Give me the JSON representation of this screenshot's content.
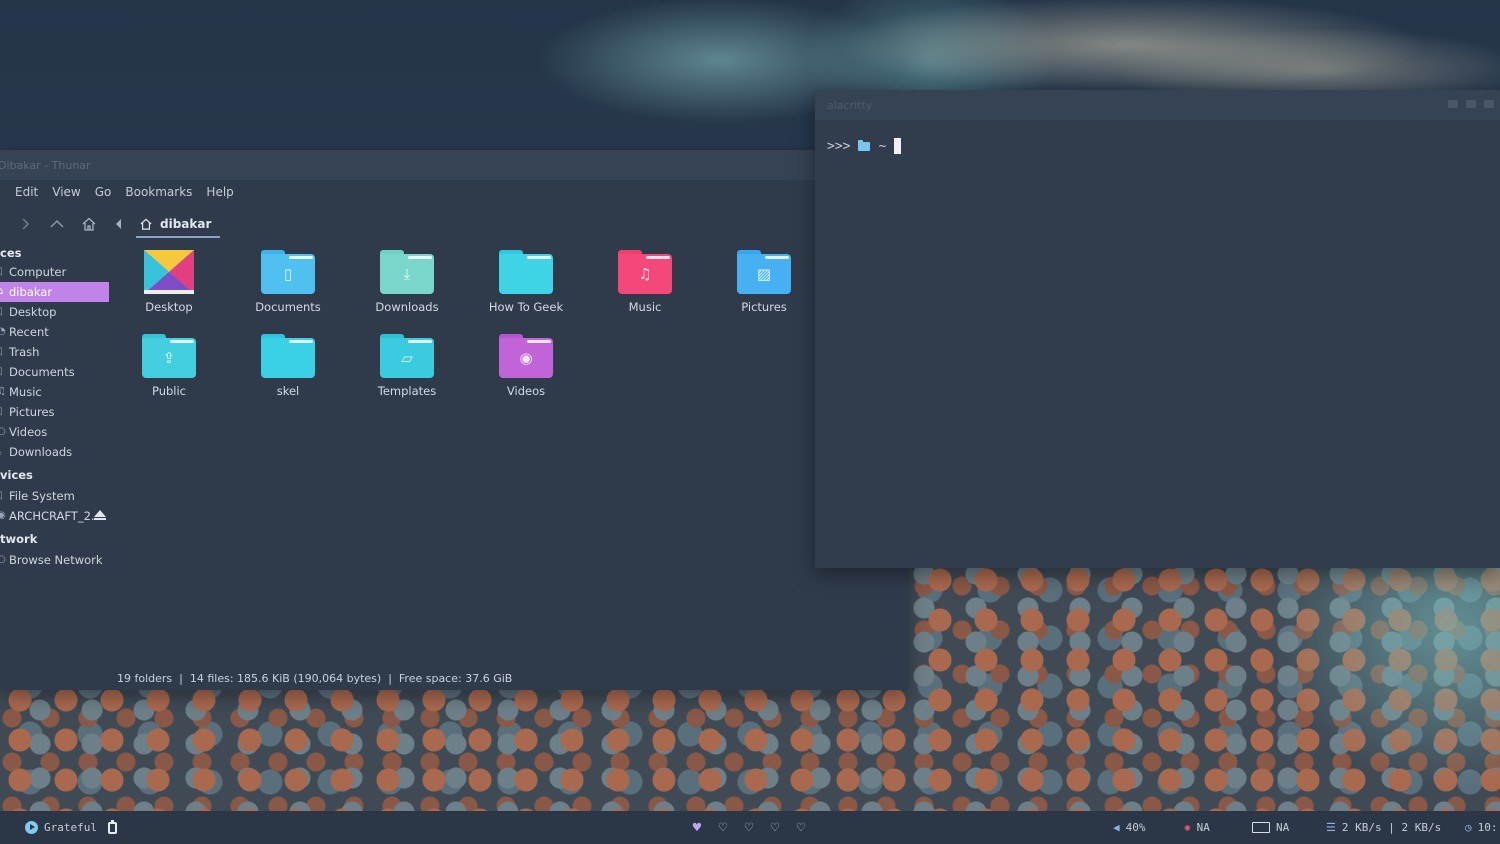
{
  "file_manager": {
    "title": "Dibakar - Thunar",
    "menu": [
      "Edit",
      "View",
      "Go",
      "Bookmarks",
      "Help"
    ],
    "path": "dibakar",
    "sidebar": {
      "places_header": "ces",
      "places": [
        {
          "label": "Computer",
          "icon": "computer-icon"
        },
        {
          "label": "dibakar",
          "icon": "home-icon",
          "active": true
        },
        {
          "label": "Desktop",
          "icon": "desktop-icon"
        },
        {
          "label": "Recent",
          "icon": "recent-icon"
        },
        {
          "label": "Trash",
          "icon": "trash-icon"
        },
        {
          "label": "Documents",
          "icon": "documents-icon"
        },
        {
          "label": "Music",
          "icon": "music-icon"
        },
        {
          "label": "Pictures",
          "icon": "pictures-icon"
        },
        {
          "label": "Videos",
          "icon": "videos-icon"
        },
        {
          "label": "Downloads",
          "icon": "downloads-icon"
        }
      ],
      "devices_header": "vices",
      "devices": [
        {
          "label": "File System",
          "icon": "drive-icon"
        },
        {
          "label": "ARCHCRAFT_2...",
          "icon": "disc-icon"
        }
      ],
      "network_header": "twork",
      "network": [
        {
          "label": "Browse Network",
          "icon": "network-icon"
        }
      ]
    },
    "items": [
      {
        "label": "Desktop",
        "kind": "desktop",
        "color": "#e06fb0"
      },
      {
        "label": "Documents",
        "kind": "folder",
        "color": "#3fb2e8",
        "icon": "document-icon"
      },
      {
        "label": "Downloads",
        "kind": "folder",
        "color": "#6fcfc0",
        "icon": "download-icon"
      },
      {
        "label": "How To Geek",
        "kind": "folder",
        "color": "#2fc8de",
        "icon": ""
      },
      {
        "label": "Music",
        "kind": "folder",
        "color": "#ef3f6e",
        "icon": "music-note-icon"
      },
      {
        "label": "Pictures",
        "kind": "folder",
        "color": "#3aa4ec",
        "icon": "image-icon"
      },
      {
        "label": "Public",
        "kind": "folder",
        "color": "#35c4d6",
        "icon": "share-icon"
      },
      {
        "label": "skel",
        "kind": "folder",
        "color": "#2cc5dd",
        "icon": ""
      },
      {
        "label": "Templates",
        "kind": "folder",
        "color": "#2cc0d6",
        "icon": "template-icon"
      },
      {
        "label": "Videos",
        "kind": "folder",
        "color": "#b455cf",
        "icon": "play-icon"
      }
    ],
    "status": "19 folders  |  14 files: 185.6 KiB (190,064 bytes)  |  Free space: 37.6 GiB"
  },
  "terminal": {
    "title": "alacritty",
    "prompt_arrows": ">>>",
    "prompt_path": "~"
  },
  "panel": {
    "now_playing": "Grateful",
    "volume": "40%",
    "network_status": "NA",
    "battery_status": "NA",
    "net_speed": "2 KB/s | 2 KB/s",
    "clock": "10:"
  }
}
